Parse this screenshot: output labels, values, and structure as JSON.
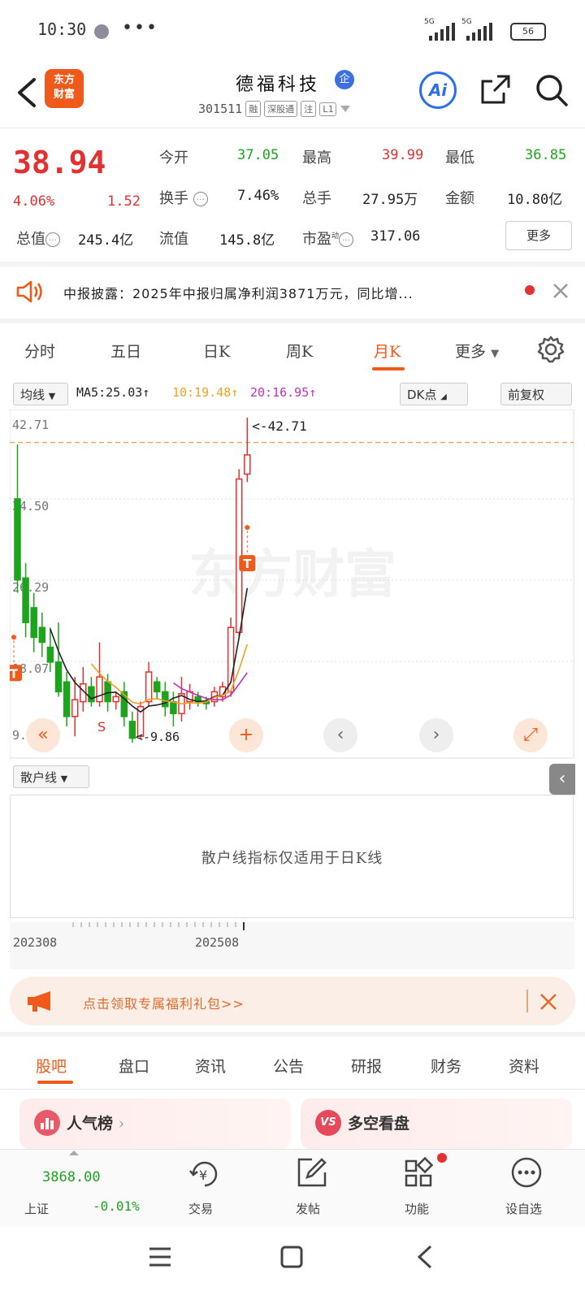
{
  "status_bar": {
    "time": "10:30",
    "more": "•••",
    "net1": "5G",
    "net2": "5G",
    "battery": "56"
  },
  "header": {
    "logo_line1": "东方",
    "logo_line2": "财富",
    "stock_name": "德福科技",
    "badge": "企",
    "code": "301511",
    "tags": [
      "融",
      "深股通",
      "注",
      "L1"
    ],
    "ai_label": "Ai"
  },
  "quote": {
    "price": "38.94",
    "change_pct": "4.06%",
    "change_amt": "1.52",
    "open_label": "今开",
    "open": "37.05",
    "high_label": "最高",
    "high": "39.99",
    "low_label": "最低",
    "low": "36.85",
    "turnover_label": "换手",
    "turnover": "7.46%",
    "volume_label": "总手",
    "volume": "27.95万",
    "amount_label": "金额",
    "amount": "10.80亿",
    "mktcap_label": "总值",
    "mktcap": "245.4亿",
    "float_label": "流值",
    "float": "145.8亿",
    "pe_label": "市盈",
    "pe_sub": "动",
    "pe": "317.06",
    "more_label": "更多"
  },
  "notice": {
    "text": "中报披露：2025年中报归属净利润3871万元，同比增..."
  },
  "k_tabs": {
    "items": [
      "分时",
      "五日",
      "日K",
      "周K",
      "月K",
      "更多"
    ],
    "active": "月K"
  },
  "ma_row": {
    "selector": "均线",
    "ma5": "MA5:25.03↑",
    "ma10": "10:19.48↑",
    "ma20": "20:16.95↑",
    "dk": "DK点",
    "adjust": "前复权"
  },
  "colors": {
    "up": "#e33030",
    "down": "#1ea31e",
    "accent": "#ef5a1a",
    "ma5": "#222222",
    "ma10": "#f0a020",
    "ma20": "#c030c0"
  },
  "chart_data": {
    "type": "candlestick",
    "y_ticks": [
      "42.71",
      "34.50",
      "26.29",
      "18.07",
      "9.86"
    ],
    "ylim": [
      9.86,
      42.71
    ],
    "max_label": "<-42.71",
    "min_label": "<-9.86",
    "marker_s": "S",
    "marker_t": "T",
    "watermark": "东方财富",
    "candles": [
      {
        "o": 34.5,
        "c": 26.3,
        "h": 40.0,
        "l": 25.0
      },
      {
        "o": 26.5,
        "c": 22.0,
        "h": 28.0,
        "l": 20.5
      },
      {
        "o": 23.5,
        "c": 20.5,
        "h": 25.0,
        "l": 19.0
      },
      {
        "o": 21.5,
        "c": 20.0,
        "h": 23.0,
        "l": 18.5
      },
      {
        "o": 19.5,
        "c": 18.0,
        "h": 21.5,
        "l": 17.0
      },
      {
        "o": 18.0,
        "c": 15.0,
        "h": 22.0,
        "l": 14.5
      },
      {
        "o": 16.0,
        "c": 12.5,
        "h": 17.0,
        "l": 11.5
      },
      {
        "o": 12.5,
        "c": 14.2,
        "h": 16.5,
        "l": 10.5
      },
      {
        "o": 14.0,
        "c": 15.8,
        "h": 17.5,
        "l": 13.0
      },
      {
        "o": 15.5,
        "c": 14.0,
        "h": 16.5,
        "l": 13.5
      },
      {
        "o": 14.0,
        "c": 16.5,
        "h": 20.0,
        "l": 13.5
      },
      {
        "o": 16.0,
        "c": 14.0,
        "h": 16.8,
        "l": 13.0
      },
      {
        "o": 14.0,
        "c": 14.5,
        "h": 15.0,
        "l": 13.2
      },
      {
        "o": 15.0,
        "c": 12.5,
        "h": 16.0,
        "l": 11.5
      },
      {
        "o": 12.0,
        "c": 10.3,
        "h": 13.0,
        "l": 9.86
      },
      {
        "o": 10.5,
        "c": 13.5,
        "h": 14.0,
        "l": 10.2
      },
      {
        "o": 14.0,
        "c": 17.0,
        "h": 18.0,
        "l": 13.5
      },
      {
        "o": 16.0,
        "c": 15.0,
        "h": 16.5,
        "l": 14.2
      },
      {
        "o": 15.0,
        "c": 13.5,
        "h": 16.0,
        "l": 12.5
      },
      {
        "o": 14.0,
        "c": 12.8,
        "h": 15.0,
        "l": 11.5
      },
      {
        "o": 12.8,
        "c": 14.8,
        "h": 16.5,
        "l": 12.0
      },
      {
        "o": 14.0,
        "c": 15.0,
        "h": 15.8,
        "l": 13.2
      },
      {
        "o": 14.5,
        "c": 14.0,
        "h": 15.0,
        "l": 13.5
      },
      {
        "o": 14.0,
        "c": 13.8,
        "h": 14.5,
        "l": 13.2
      },
      {
        "o": 14.0,
        "c": 15.0,
        "h": 15.5,
        "l": 13.5
      },
      {
        "o": 14.5,
        "c": 15.5,
        "h": 16.0,
        "l": 14.0
      },
      {
        "o": 15.0,
        "c": 21.5,
        "h": 22.5,
        "l": 14.5
      },
      {
        "o": 21.0,
        "c": 36.5,
        "h": 37.5,
        "l": 20.5
      },
      {
        "o": 37.0,
        "c": 38.94,
        "h": 42.71,
        "l": 36.2
      }
    ]
  },
  "sub_chart": {
    "selector": "散户线",
    "message": "散户线指标仅适用于日K线",
    "x_start": "202308",
    "x_end": "202508"
  },
  "promo": {
    "text": "点击领取专属福利礼包>>"
  },
  "bottom_tabs": {
    "items": [
      "股吧",
      "盘口",
      "资讯",
      "公告",
      "研报",
      "财务",
      "资料"
    ],
    "active": "股吧"
  },
  "cards": [
    {
      "title": "人气榜"
    },
    {
      "title": "多空看盘"
    }
  ],
  "bottom_bar": {
    "index_value": "3868.00",
    "index_name": "上证",
    "index_change": "-0.01%",
    "trade": "交易",
    "post": "发帖",
    "functions": "功能",
    "watchlist": "设自选"
  }
}
